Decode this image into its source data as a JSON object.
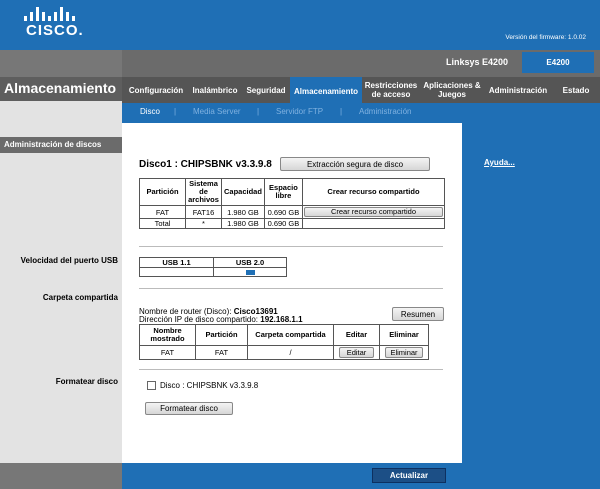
{
  "header": {
    "logo_text": "CISCO.",
    "firmware": "Versión del firmware: 1.0.02",
    "model_name": "Linksys E4200",
    "model_box": "E4200"
  },
  "page_title": "Almacenamiento",
  "nav": {
    "tabs": [
      {
        "label": "Configuración"
      },
      {
        "label": "Inalámbrico"
      },
      {
        "label": "Seguridad"
      },
      {
        "label": "Almacenamiento"
      },
      {
        "label": "Restricciones de acceso"
      },
      {
        "label": "Aplicaciones & Juegos"
      },
      {
        "label": "Administración"
      },
      {
        "label": "Estado"
      }
    ],
    "subtabs": [
      {
        "label": "Disco"
      },
      {
        "label": "Media Server"
      },
      {
        "label": "Servidor FTP"
      },
      {
        "label": "Administración"
      }
    ],
    "separator": "|"
  },
  "side": {
    "section_title": "Administración de discos",
    "usb_speed": "Velocidad del puerto USB",
    "shared_folder": "Carpeta compartida",
    "format": "Formatear disco"
  },
  "disk": {
    "title": "Disco1 : CHIPSBNK v3.3.9.8",
    "safe_remove_button": "Extracción segura de disco",
    "table_headers": [
      "Partición",
      "Sistema de archivos",
      "Capacidad",
      "Espacio libre",
      "Crear recurso compartido"
    ],
    "rows": [
      {
        "partition": "FAT",
        "fs": "FAT16",
        "capacity": "1.980 GB",
        "free": "0.690 GB",
        "action": "Crear recurso compartido"
      },
      {
        "partition": "Total",
        "fs": "*",
        "capacity": "1.980 GB",
        "free": "0.690 GB",
        "action": ""
      }
    ]
  },
  "usb": {
    "headers": [
      "USB 1.1",
      "USB 2.0"
    ],
    "active_index": 1
  },
  "share": {
    "router_name_label": "Nombre de router (Disco):",
    "router_name": "Cisco13691",
    "ip_label": "Dirección IP de disco compartido:",
    "ip": "192.168.1.1",
    "summary_button": "Resumen",
    "table_headers": [
      "Nombre mostrado",
      "Partición",
      "Carpeta compartida",
      "Editar",
      "Eliminar"
    ],
    "rows": [
      {
        "name": "FAT",
        "partition": "FAT",
        "folder": "/",
        "edit": "Editar",
        "delete": "Eliminar"
      }
    ]
  },
  "format": {
    "checkbox_label": "Disco : CHIPSBNK v3.3.9.8",
    "button": "Formatear disco"
  },
  "help_link": "Ayuda...",
  "save_button": "Actualizar",
  "colors": {
    "brand_blue": "#1f6fb5",
    "dark_gray": "#555555",
    "mid_gray": "#6b6b6b"
  }
}
